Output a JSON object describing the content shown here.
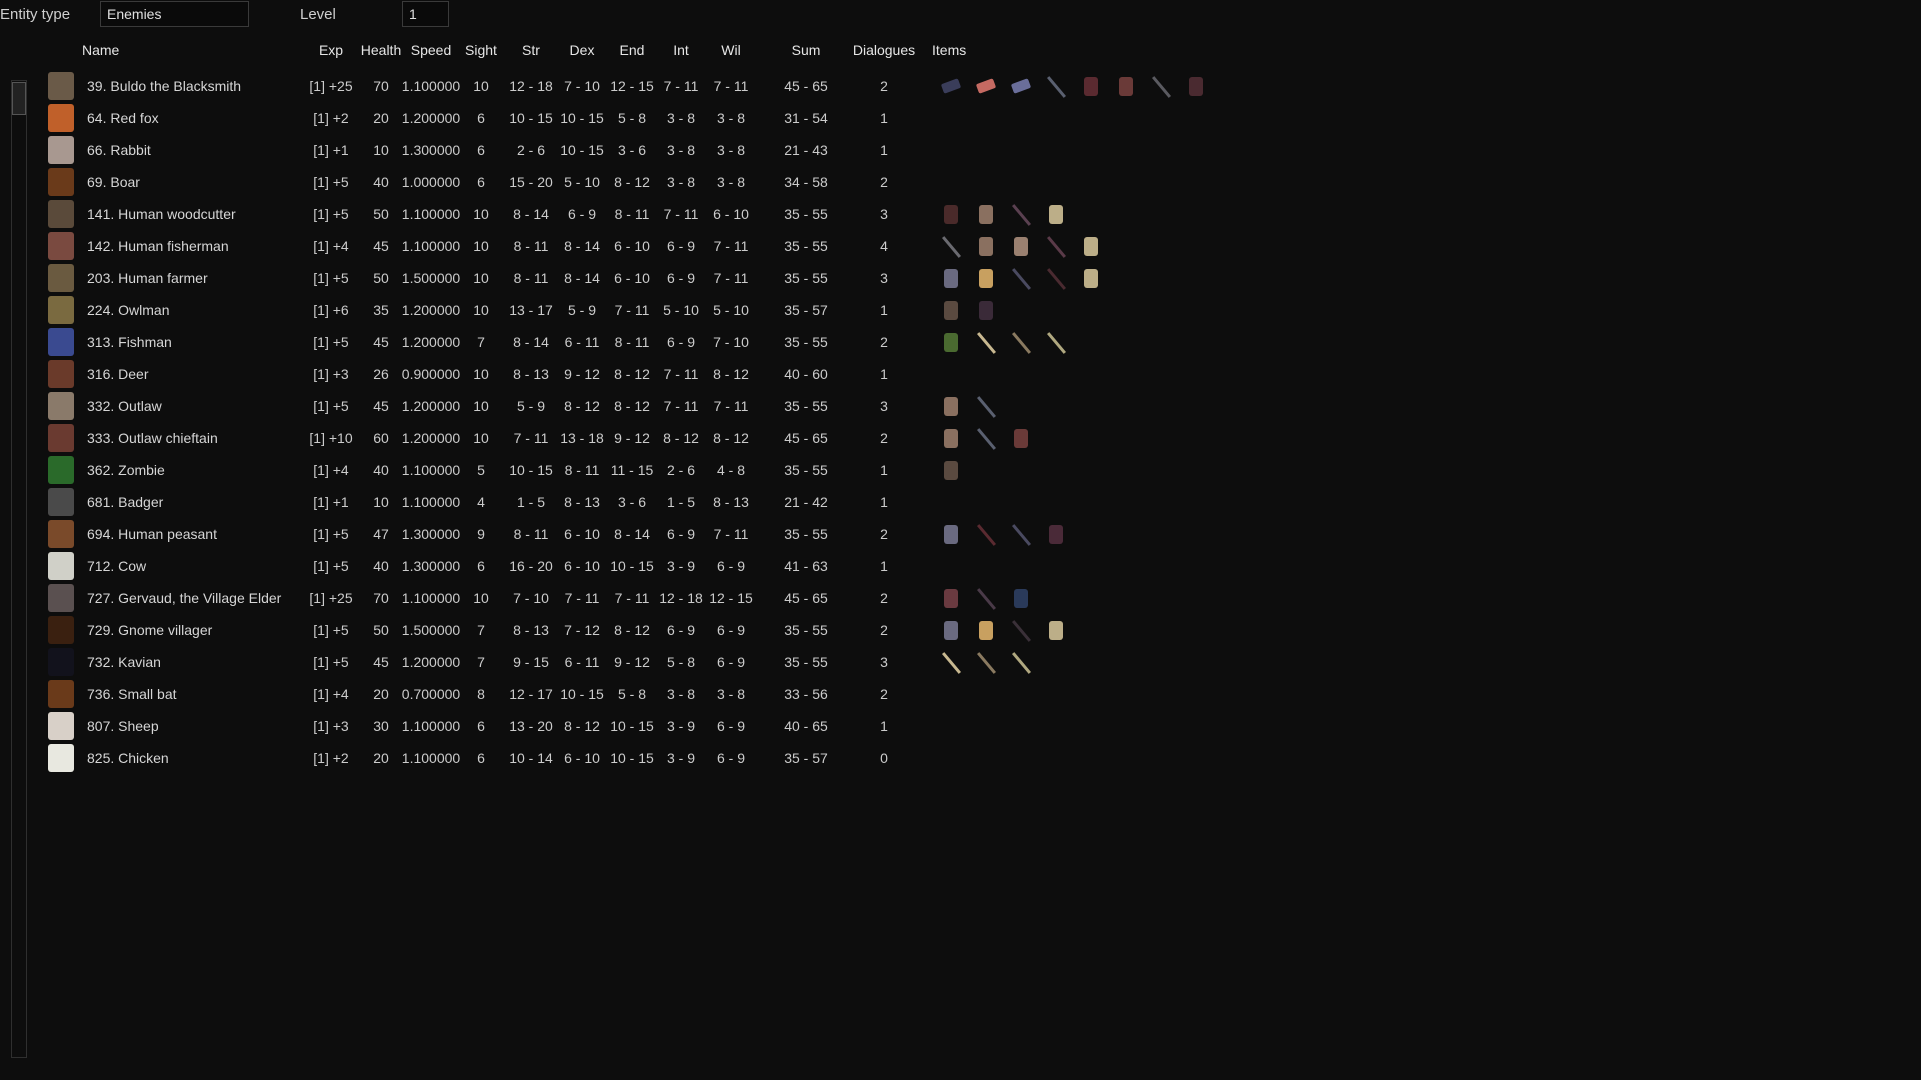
{
  "filters": {
    "entity_type_label": "Entity type",
    "entity_type_value": "Enemies",
    "level_label": "Level",
    "level_value": "1"
  },
  "columns": [
    "Name",
    "Exp",
    "Health",
    "Speed",
    "Sight",
    "Str",
    "Dex",
    "End",
    "Int",
    "Wil",
    "Sum",
    "Dialogues",
    "Items"
  ],
  "rows": [
    {
      "name": "39. Buldo the Blacksmith",
      "sprite": "#6a5a48",
      "exp": "[1] +25",
      "health": "70",
      "speed": "1.100000",
      "sight": "10",
      "str": "12 - 18",
      "dex": "7 - 10",
      "end": "12 - 15",
      "int": "7 - 11",
      "wil": "7 - 11",
      "sum": "45 - 65",
      "dialogues": "2",
      "items": [
        {
          "icon": "ingot",
          "color": "#3a3d5a"
        },
        {
          "icon": "ingot",
          "color": "#c56a62"
        },
        {
          "icon": "ingot",
          "color": "#6a6e9a"
        },
        {
          "icon": "sword",
          "color": "#5a6070"
        },
        {
          "icon": "belt",
          "color": "#5a2a30"
        },
        {
          "icon": "gloves",
          "color": "#6a3a38"
        },
        {
          "icon": "hammer",
          "color": "#5a5a60"
        },
        {
          "icon": "apron",
          "color": "#4a2a30"
        }
      ]
    },
    {
      "name": "64. Red fox",
      "sprite": "#c0602a",
      "exp": "[1] +2",
      "health": "20",
      "speed": "1.200000",
      "sight": "6",
      "str": "10 - 15",
      "dex": "10 - 15",
      "end": "5 - 8",
      "int": "3 - 8",
      "wil": "3 - 8",
      "sum": "31 - 54",
      "dialogues": "1",
      "items": []
    },
    {
      "name": "66. Rabbit",
      "sprite": "#a89890",
      "exp": "[1] +1",
      "health": "10",
      "speed": "1.300000",
      "sight": "6",
      "str": "2 - 6",
      "dex": "10 - 15",
      "end": "3 - 6",
      "int": "3 - 8",
      "wil": "3 - 8",
      "sum": "21 - 43",
      "dialogues": "1",
      "items": []
    },
    {
      "name": "69. Boar",
      "sprite": "#6a3a1a",
      "exp": "[1] +5",
      "health": "40",
      "speed": "1.000000",
      "sight": "6",
      "str": "15 - 20",
      "dex": "5 - 10",
      "end": "8 - 12",
      "int": "3 - 8",
      "wil": "3 - 8",
      "sum": "34 - 58",
      "dialogues": "2",
      "items": []
    },
    {
      "name": "141. Human woodcutter",
      "sprite": "#5a4a3a",
      "exp": "[1] +5",
      "health": "50",
      "speed": "1.100000",
      "sight": "10",
      "str": "8 - 14",
      "dex": "6 - 9",
      "end": "8 - 11",
      "int": "7 - 11",
      "wil": "6 - 10",
      "sum": "35 - 55",
      "dialogues": "3",
      "items": [
        {
          "icon": "log",
          "color": "#4a2a2a"
        },
        {
          "icon": "trousers",
          "color": "#8a7060"
        },
        {
          "icon": "axe",
          "color": "#5a4050"
        },
        {
          "icon": "shirt",
          "color": "#bcae88"
        }
      ]
    },
    {
      "name": "142. Human fisherman",
      "sprite": "#7a4a40",
      "exp": "[1] +4",
      "health": "45",
      "speed": "1.100000",
      "sight": "10",
      "str": "8 - 11",
      "dex": "8 - 14",
      "end": "6 - 10",
      "int": "6 - 9",
      "wil": "7 - 11",
      "sum": "35 - 55",
      "dialogues": "4",
      "items": [
        {
          "icon": "knife",
          "color": "#6a6a70"
        },
        {
          "icon": "trousers",
          "color": "#8a7060"
        },
        {
          "icon": "skirt",
          "color": "#9a8070"
        },
        {
          "icon": "fishing-rod",
          "color": "#5a3a48"
        },
        {
          "icon": "shirt",
          "color": "#bcae88"
        }
      ]
    },
    {
      "name": "203. Human farmer",
      "sprite": "#6a5a40",
      "exp": "[1] +5",
      "health": "50",
      "speed": "1.500000",
      "sight": "10",
      "str": "8 - 11",
      "dex": "8 - 14",
      "end": "6 - 10",
      "int": "6 - 9",
      "wil": "7 - 11",
      "sum": "35 - 55",
      "dialogues": "3",
      "items": [
        {
          "icon": "shears",
          "color": "#6a6a80"
        },
        {
          "icon": "hat",
          "color": "#c8a060"
        },
        {
          "icon": "scythe",
          "color": "#4a4a60"
        },
        {
          "icon": "staff",
          "color": "#4a2a30"
        },
        {
          "icon": "shirt",
          "color": "#bcae88"
        }
      ]
    },
    {
      "name": "224. Owlman",
      "sprite": "#7a6a40",
      "exp": "[1] +6",
      "health": "35",
      "speed": "1.200000",
      "sight": "10",
      "str": "13 - 17",
      "dex": "5 - 9",
      "end": "7 - 11",
      "int": "5 - 10",
      "wil": "5 - 10",
      "sum": "35 - 57",
      "dialogues": "1",
      "items": [
        {
          "icon": "claws",
          "color": "#5a4a40"
        },
        {
          "icon": "robe",
          "color": "#3a2a38"
        }
      ]
    },
    {
      "name": "313. Fishman",
      "sprite": "#3a4a90",
      "exp": "[1] +5",
      "health": "45",
      "speed": "1.200000",
      "sight": "7",
      "str": "8 - 14",
      "dex": "6 - 11",
      "end": "8 - 11",
      "int": "6 - 9",
      "wil": "7 - 10",
      "sum": "35 - 55",
      "dialogues": "2",
      "items": [
        {
          "icon": "fish",
          "color": "#4a6a30"
        },
        {
          "icon": "dagger",
          "color": "#c8b890"
        },
        {
          "icon": "spear",
          "color": "#8a7a60"
        },
        {
          "icon": "sword",
          "color": "#b0a880"
        }
      ]
    },
    {
      "name": "316. Deer",
      "sprite": "#6a3a2a",
      "exp": "[1] +3",
      "health": "26",
      "speed": "0.900000",
      "sight": "10",
      "str": "8 - 13",
      "dex": "9 - 12",
      "end": "8 - 12",
      "int": "7 - 11",
      "wil": "8 - 12",
      "sum": "40 - 60",
      "dialogues": "1",
      "items": []
    },
    {
      "name": "332. Outlaw",
      "sprite": "#8a7a6a",
      "exp": "[1] +5",
      "health": "45",
      "speed": "1.200000",
      "sight": "10",
      "str": "5 - 9",
      "dex": "8 - 12",
      "end": "8 - 12",
      "int": "7 - 11",
      "wil": "7 - 11",
      "sum": "35 - 55",
      "dialogues": "3",
      "items": [
        {
          "icon": "trousers",
          "color": "#8a7060"
        },
        {
          "icon": "sword",
          "color": "#5a6070"
        }
      ]
    },
    {
      "name": "333. Outlaw chieftain",
      "sprite": "#6a3a30",
      "exp": "[1] +10",
      "health": "60",
      "speed": "1.200000",
      "sight": "10",
      "str": "7 - 11",
      "dex": "13 - 18",
      "end": "9 - 12",
      "int": "8 - 12",
      "wil": "8 - 12",
      "sum": "45 - 65",
      "dialogues": "2",
      "items": [
        {
          "icon": "trousers",
          "color": "#8a7060"
        },
        {
          "icon": "sword",
          "color": "#5a6070"
        },
        {
          "icon": "armor",
          "color": "#6a3a38"
        }
      ]
    },
    {
      "name": "362. Zombie",
      "sprite": "#2a6a2a",
      "exp": "[1] +4",
      "health": "40",
      "speed": "1.100000",
      "sight": "5",
      "str": "10 - 15",
      "dex": "8 - 11",
      "end": "11 - 15",
      "int": "2 - 6",
      "wil": "4 - 8",
      "sum": "35 - 55",
      "dialogues": "1",
      "items": [
        {
          "icon": "claws",
          "color": "#5a4a40"
        }
      ]
    },
    {
      "name": "681. Badger",
      "sprite": "#4a4a4a",
      "exp": "[1] +1",
      "health": "10",
      "speed": "1.100000",
      "sight": "4",
      "str": "1 - 5",
      "dex": "8 - 13",
      "end": "3 - 6",
      "int": "1 - 5",
      "wil": "8 - 13",
      "sum": "21 - 42",
      "dialogues": "1",
      "items": []
    },
    {
      "name": "694. Human peasant",
      "sprite": "#7a4a2a",
      "exp": "[1] +5",
      "health": "47",
      "speed": "1.300000",
      "sight": "9",
      "str": "8 - 11",
      "dex": "6 - 10",
      "end": "8 - 14",
      "int": "6 - 9",
      "wil": "7 - 11",
      "sum": "35 - 55",
      "dialogues": "2",
      "items": [
        {
          "icon": "shears",
          "color": "#6a6a80"
        },
        {
          "icon": "staff",
          "color": "#5a2a30"
        },
        {
          "icon": "scythe",
          "color": "#4a4a60"
        },
        {
          "icon": "robe",
          "color": "#4a2a38"
        }
      ]
    },
    {
      "name": "712. Cow",
      "sprite": "#d0d0c8",
      "exp": "[1] +5",
      "health": "40",
      "speed": "1.300000",
      "sight": "6",
      "str": "16 - 20",
      "dex": "6 - 10",
      "end": "10 - 15",
      "int": "3 - 9",
      "wil": "6 - 9",
      "sum": "41 - 63",
      "dialogues": "1",
      "items": []
    },
    {
      "name": "727. Gervaud, the Village Elder",
      "sprite": "#5a5050",
      "exp": "[1] +25",
      "health": "70",
      "speed": "1.100000",
      "sight": "10",
      "str": "7 - 10",
      "dex": "7 - 11",
      "end": "7 - 11",
      "int": "12 - 18",
      "wil": "12 - 15",
      "sum": "45 - 65",
      "dialogues": "2",
      "items": [
        {
          "icon": "bread",
          "color": "#6a3a40"
        },
        {
          "icon": "cane",
          "color": "#4a3a48"
        },
        {
          "icon": "robe",
          "color": "#2a3a5a"
        }
      ]
    },
    {
      "name": "729. Gnome villager",
      "sprite": "#3a2010",
      "exp": "[1] +5",
      "health": "50",
      "speed": "1.500000",
      "sight": "7",
      "str": "8 - 13",
      "dex": "7 - 12",
      "end": "8 - 12",
      "int": "6 - 9",
      "wil": "6 - 9",
      "sum": "35 - 55",
      "dialogues": "2",
      "items": [
        {
          "icon": "shears",
          "color": "#6a6a80"
        },
        {
          "icon": "hat",
          "color": "#c8a060"
        },
        {
          "icon": "pitchfork",
          "color": "#3a3038"
        },
        {
          "icon": "shirt",
          "color": "#bcae88"
        }
      ]
    },
    {
      "name": "732. Kavian",
      "sprite": "#12121c",
      "exp": "[1] +5",
      "health": "45",
      "speed": "1.200000",
      "sight": "7",
      "str": "9 - 15",
      "dex": "6 - 11",
      "end": "9 - 12",
      "int": "5 - 8",
      "wil": "6 - 9",
      "sum": "35 - 55",
      "dialogues": "3",
      "items": [
        {
          "icon": "dagger",
          "color": "#c8b890"
        },
        {
          "icon": "spear",
          "color": "#8a7a60"
        },
        {
          "icon": "sword",
          "color": "#b0a880"
        }
      ]
    },
    {
      "name": "736. Small bat",
      "sprite": "#6a3a1a",
      "exp": "[1] +4",
      "health": "20",
      "speed": "0.700000",
      "sight": "8",
      "str": "12 - 17",
      "dex": "10 - 15",
      "end": "5 - 8",
      "int": "3 - 8",
      "wil": "3 - 8",
      "sum": "33 - 56",
      "dialogues": "2",
      "items": []
    },
    {
      "name": "807. Sheep",
      "sprite": "#d8d0c8",
      "exp": "[1] +3",
      "health": "30",
      "speed": "1.100000",
      "sight": "6",
      "str": "13 - 20",
      "dex": "8 - 12",
      "end": "10 - 15",
      "int": "3 - 9",
      "wil": "6 - 9",
      "sum": "40 - 65",
      "dialogues": "1",
      "items": []
    },
    {
      "name": "825. Chicken",
      "sprite": "#e8e8e0",
      "exp": "[1] +2",
      "health": "20",
      "speed": "1.100000",
      "sight": "6",
      "str": "10 - 14",
      "dex": "6 - 10",
      "end": "10 - 15",
      "int": "3 - 9",
      "wil": "6 - 9",
      "sum": "35 - 57",
      "dialogues": "0",
      "items": []
    }
  ]
}
